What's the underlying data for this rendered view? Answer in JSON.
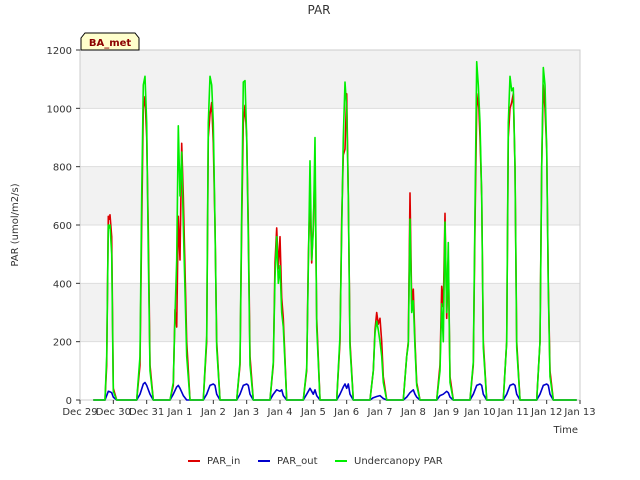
{
  "chart_data": {
    "type": "line",
    "title": "PAR",
    "xlabel": "Time",
    "ylabel": "PAR (umol/m2/s)",
    "badge": "BA_met",
    "xlim": [
      0,
      15
    ],
    "ylim": [
      0,
      1200
    ],
    "x_ticks": [
      {
        "x": 0,
        "label": "Dec 29"
      },
      {
        "x": 1,
        "label": "Dec 30"
      },
      {
        "x": 2,
        "label": "Dec 31"
      },
      {
        "x": 3,
        "label": "Jan 1"
      },
      {
        "x": 4,
        "label": "Jan 2"
      },
      {
        "x": 5,
        "label": "Jan 3"
      },
      {
        "x": 6,
        "label": "Jan 4"
      },
      {
        "x": 7,
        "label": "Jan 5"
      },
      {
        "x": 8,
        "label": "Jan 6"
      },
      {
        "x": 9,
        "label": "Jan 7"
      },
      {
        "x": 10,
        "label": "Jan 8"
      },
      {
        "x": 11,
        "label": "Jan 9"
      },
      {
        "x": 12,
        "label": "Jan 10"
      },
      {
        "x": 13,
        "label": "Jan 11"
      },
      {
        "x": 14,
        "label": "Jan 12"
      },
      {
        "x": 15,
        "label": "Jan 13"
      }
    ],
    "y_ticks": [
      0,
      200,
      400,
      600,
      800,
      1000,
      1200
    ],
    "grid": true,
    "legend_position": "bottom",
    "series": [
      {
        "name": "PAR_in",
        "color": "#dd0000",
        "x": [
          0.4,
          0.75,
          0.8,
          0.85,
          0.88,
          0.9,
          0.95,
          1.0,
          1.1,
          1.25,
          1.7,
          1.8,
          1.85,
          1.9,
          1.95,
          2.0,
          2.05,
          2.1,
          2.2,
          2.3,
          2.7,
          2.8,
          2.85,
          2.9,
          2.95,
          3.0,
          3.05,
          3.1,
          3.2,
          3.3,
          3.7,
          3.8,
          3.85,
          3.9,
          3.95,
          4.0,
          4.05,
          4.1,
          4.2,
          4.3,
          4.7,
          4.8,
          4.85,
          4.9,
          4.95,
          5.0,
          5.05,
          5.1,
          5.2,
          5.3,
          5.7,
          5.8,
          5.85,
          5.9,
          5.95,
          6.0,
          6.05,
          6.1,
          6.2,
          6.3,
          6.7,
          6.8,
          6.85,
          6.9,
          6.95,
          7.0,
          7.05,
          7.1,
          7.2,
          7.3,
          7.7,
          7.8,
          7.85,
          7.9,
          7.95,
          8.0,
          8.05,
          8.1,
          8.2,
          8.3,
          8.7,
          8.8,
          8.85,
          8.9,
          8.95,
          9.0,
          9.05,
          9.1,
          9.2,
          9.3,
          9.7,
          9.8,
          9.85,
          9.9,
          9.95,
          10.0,
          10.05,
          10.1,
          10.2,
          10.3,
          10.7,
          10.8,
          10.85,
          10.9,
          10.95,
          11.0,
          11.05,
          11.1,
          11.2,
          11.3,
          11.7,
          11.8,
          11.85,
          11.9,
          11.95,
          12.0,
          12.05,
          12.1,
          12.2,
          12.3,
          12.7,
          12.8,
          12.85,
          12.9,
          12.95,
          13.0,
          13.05,
          13.1,
          13.2,
          13.3,
          13.7,
          13.8,
          13.85,
          13.9,
          13.95,
          14.0,
          14.05,
          14.1,
          14.2,
          14.3,
          14.9
        ],
        "y": [
          0,
          0,
          120,
          630,
          620,
          635,
          560,
          40,
          0,
          0,
          0,
          120,
          600,
          1000,
          1040,
          900,
          580,
          120,
          0,
          0,
          0,
          50,
          310,
          250,
          630,
          480,
          880,
          700,
          200,
          0,
          0,
          200,
          900,
          980,
          1020,
          880,
          600,
          200,
          0,
          0,
          0,
          120,
          600,
          950,
          1010,
          900,
          600,
          150,
          0,
          0,
          0,
          120,
          470,
          590,
          450,
          560,
          350,
          280,
          0,
          0,
          0,
          100,
          480,
          710,
          470,
          600,
          800,
          280,
          0,
          0,
          0,
          200,
          620,
          840,
          860,
          1050,
          700,
          200,
          0,
          0,
          0,
          100,
          240,
          300,
          260,
          280,
          200,
          80,
          0,
          0,
          0,
          150,
          200,
          710,
          330,
          380,
          200,
          60,
          0,
          0,
          0,
          120,
          390,
          320,
          640,
          280,
          480,
          80,
          0,
          0,
          0,
          120,
          600,
          1000,
          1050,
          900,
          700,
          200,
          0,
          0,
          0,
          200,
          900,
          1000,
          1020,
          1050,
          800,
          200,
          0,
          0,
          0,
          200,
          800,
          1080,
          1000,
          860,
          400,
          100,
          0,
          0,
          0
        ]
      },
      {
        "name": "PAR_out",
        "color": "#0000cc",
        "x": [
          0.4,
          0.75,
          0.8,
          0.85,
          0.9,
          0.95,
          1.0,
          1.1,
          1.7,
          1.8,
          1.9,
          1.95,
          2.0,
          2.1,
          2.2,
          2.7,
          2.8,
          2.9,
          2.95,
          3.0,
          3.1,
          3.2,
          3.7,
          3.8,
          3.9,
          4.0,
          4.05,
          4.1,
          4.2,
          4.7,
          4.8,
          4.9,
          5.0,
          5.05,
          5.1,
          5.2,
          5.7,
          5.8,
          5.9,
          6.0,
          6.05,
          6.1,
          6.2,
          6.7,
          6.8,
          6.9,
          7.0,
          7.05,
          7.1,
          7.2,
          7.7,
          7.8,
          7.9,
          7.95,
          8.0,
          8.05,
          8.1,
          8.2,
          8.7,
          8.8,
          8.9,
          9.0,
          9.05,
          9.1,
          9.2,
          9.7,
          9.8,
          9.9,
          10.0,
          10.05,
          10.1,
          10.2,
          10.7,
          10.8,
          10.9,
          11.0,
          11.05,
          11.1,
          11.2,
          11.7,
          11.8,
          11.9,
          12.0,
          12.05,
          12.1,
          12.2,
          12.7,
          12.8,
          12.9,
          13.0,
          13.05,
          13.1,
          13.2,
          13.7,
          13.8,
          13.9,
          14.0,
          14.05,
          14.1,
          14.2,
          14.9
        ],
        "y": [
          0,
          0,
          15,
          30,
          28,
          25,
          10,
          0,
          0,
          20,
          55,
          60,
          50,
          20,
          0,
          0,
          20,
          45,
          50,
          40,
          15,
          0,
          0,
          20,
          50,
          55,
          50,
          20,
          0,
          0,
          20,
          50,
          55,
          50,
          20,
          0,
          0,
          20,
          35,
          30,
          35,
          15,
          0,
          0,
          20,
          40,
          20,
          35,
          15,
          0,
          0,
          20,
          45,
          55,
          40,
          55,
          20,
          0,
          0,
          8,
          12,
          15,
          10,
          5,
          0,
          0,
          10,
          25,
          35,
          20,
          10,
          0,
          0,
          15,
          20,
          30,
          25,
          10,
          0,
          0,
          20,
          50,
          55,
          50,
          20,
          0,
          0,
          20,
          50,
          55,
          50,
          20,
          0,
          0,
          20,
          50,
          55,
          50,
          20,
          0,
          0
        ]
      },
      {
        "name": "Undercanopy PAR",
        "color": "#00ee00",
        "x": [
          0.4,
          0.75,
          0.8,
          0.85,
          0.88,
          0.9,
          0.95,
          1.0,
          1.1,
          1.25,
          1.7,
          1.8,
          1.85,
          1.9,
          1.95,
          2.0,
          2.05,
          2.1,
          2.2,
          2.3,
          2.7,
          2.8,
          2.85,
          2.9,
          2.95,
          3.0,
          3.05,
          3.1,
          3.2,
          3.3,
          3.7,
          3.8,
          3.85,
          3.9,
          3.95,
          4.0,
          4.05,
          4.1,
          4.2,
          4.3,
          4.7,
          4.8,
          4.85,
          4.9,
          4.95,
          5.0,
          5.05,
          5.1,
          5.2,
          5.3,
          5.7,
          5.8,
          5.85,
          5.9,
          5.95,
          6.0,
          6.05,
          6.1,
          6.2,
          6.3,
          6.7,
          6.8,
          6.85,
          6.9,
          6.95,
          7.0,
          7.05,
          7.1,
          7.2,
          7.3,
          7.7,
          7.8,
          7.85,
          7.9,
          7.95,
          8.0,
          8.05,
          8.1,
          8.2,
          8.3,
          8.7,
          8.8,
          8.85,
          8.9,
          8.95,
          9.0,
          9.05,
          9.1,
          9.2,
          9.3,
          9.7,
          9.8,
          9.85,
          9.9,
          9.95,
          10.0,
          10.05,
          10.1,
          10.2,
          10.3,
          10.7,
          10.8,
          10.85,
          10.9,
          10.95,
          11.0,
          11.05,
          11.1,
          11.2,
          11.3,
          11.7,
          11.8,
          11.85,
          11.9,
          11.95,
          12.0,
          12.05,
          12.1,
          12.2,
          12.3,
          12.7,
          12.8,
          12.85,
          12.9,
          12.95,
          13.0,
          13.05,
          13.1,
          13.2,
          13.3,
          13.7,
          13.8,
          13.85,
          13.9,
          13.95,
          14.0,
          14.05,
          14.1,
          14.2,
          14.3,
          14.9
        ],
        "y": [
          0,
          0,
          150,
          600,
          590,
          600,
          500,
          30,
          0,
          0,
          0,
          150,
          700,
          1080,
          1110,
          950,
          500,
          100,
          0,
          0,
          0,
          60,
          290,
          480,
          940,
          700,
          850,
          600,
          150,
          0,
          0,
          220,
          950,
          1110,
          1080,
          950,
          600,
          180,
          0,
          0,
          0,
          130,
          650,
          1090,
          1095,
          900,
          550,
          120,
          0,
          0,
          0,
          130,
          420,
          560,
          400,
          460,
          300,
          250,
          0,
          0,
          0,
          110,
          450,
          820,
          480,
          580,
          900,
          250,
          0,
          0,
          0,
          220,
          580,
          900,
          1090,
          1000,
          700,
          180,
          0,
          0,
          0,
          100,
          230,
          270,
          240,
          200,
          150,
          60,
          0,
          0,
          0,
          150,
          190,
          620,
          300,
          340,
          180,
          50,
          0,
          0,
          0,
          100,
          330,
          200,
          610,
          300,
          540,
          60,
          0,
          0,
          0,
          130,
          650,
          1160,
          1080,
          950,
          700,
          180,
          0,
          0,
          0,
          200,
          950,
          1110,
          1060,
          1070,
          800,
          180,
          0,
          0,
          0,
          200,
          800,
          1140,
          1080,
          860,
          380,
          80,
          0,
          0,
          0
        ]
      }
    ]
  }
}
